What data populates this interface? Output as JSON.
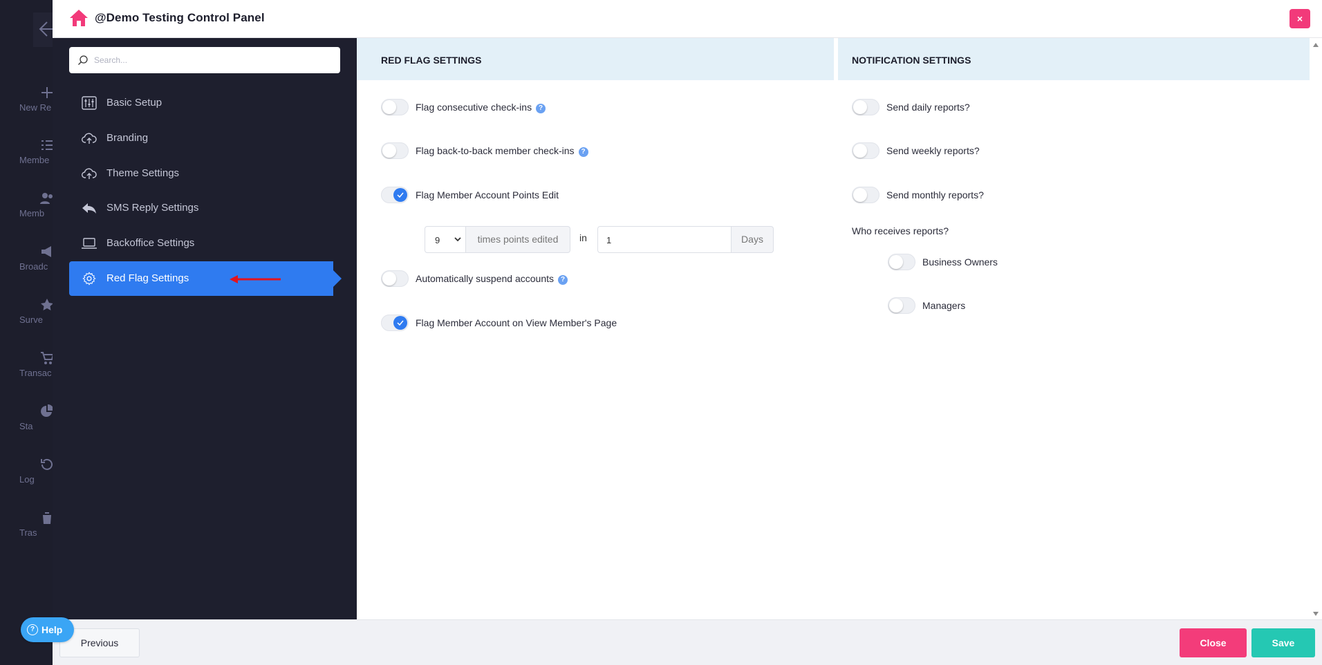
{
  "app_rail": {
    "items": [
      {
        "label": "New Re",
        "icon": "plus-icon"
      },
      {
        "label": "Membe",
        "icon": "list-icon"
      },
      {
        "label": "Memb",
        "icon": "users-icon"
      },
      {
        "label": "Broadc",
        "icon": "megaphone-icon"
      },
      {
        "label": "Surve",
        "icon": "star-icon"
      },
      {
        "label": "Transac",
        "icon": "cart-icon"
      },
      {
        "label": "Sta",
        "icon": "pie-chart-icon"
      },
      {
        "label": "Log",
        "icon": "history-icon"
      },
      {
        "label": "Tras",
        "icon": "trash-icon"
      }
    ]
  },
  "modal": {
    "title": "@Demo Testing Control Panel",
    "close_symbol": "×"
  },
  "sidebar": {
    "search_placeholder": "Search...",
    "items": [
      {
        "label": "Basic Setup",
        "icon": "sliders-icon",
        "active": false
      },
      {
        "label": "Branding",
        "icon": "cloud-upload-icon",
        "active": false
      },
      {
        "label": "Theme Settings",
        "icon": "cloud-upload-icon",
        "active": false
      },
      {
        "label": "SMS Reply Settings",
        "icon": "reply-icon",
        "active": false
      },
      {
        "label": "Backoffice Settings",
        "icon": "laptop-icon",
        "active": false
      },
      {
        "label": "Red Flag Settings",
        "icon": "gear-icon",
        "active": true
      }
    ]
  },
  "red_flag": {
    "heading": "RED FLAG SETTINGS",
    "toggles": [
      {
        "label": "Flag consecutive check-ins",
        "on": false,
        "help": true
      },
      {
        "label": "Flag back-to-back member check-ins",
        "on": false,
        "help": true
      },
      {
        "label": "Flag Member Account Points Edit",
        "on": true,
        "help": false
      },
      {
        "label": "Automatically suspend accounts",
        "on": false,
        "help": true
      },
      {
        "label": "Flag Member Account on View Member's Page",
        "on": true,
        "help": false
      }
    ],
    "points_edit": {
      "times_value": "9",
      "times_addon": "times points edited",
      "in_label": "in",
      "days_value": "1",
      "days_addon": "Days"
    }
  },
  "notifications": {
    "heading": "NOTIFICATION SETTINGS",
    "toggles": [
      {
        "label": "Send daily reports?",
        "on": false
      },
      {
        "label": "Send weekly reports?",
        "on": false
      },
      {
        "label": "Send monthly reports?",
        "on": false
      }
    ],
    "who_label": "Who receives reports?",
    "recipients": [
      {
        "label": "Business Owners",
        "on": false
      },
      {
        "label": "Managers",
        "on": false
      }
    ]
  },
  "footer": {
    "previous_label": "Previous",
    "close_label": "Close",
    "save_label": "Save"
  },
  "help": {
    "label": "Help",
    "symbol": "?"
  },
  "colors": {
    "accent": "#2f7bf0",
    "sidebar_bg": "#1e1f2e",
    "section_header_bg": "#e3f0f8",
    "close_btn": "#f33c7a",
    "save_btn": "#25c8b3",
    "home_icon": "#f23a7a",
    "annotation_arrow": "#e3141e"
  }
}
